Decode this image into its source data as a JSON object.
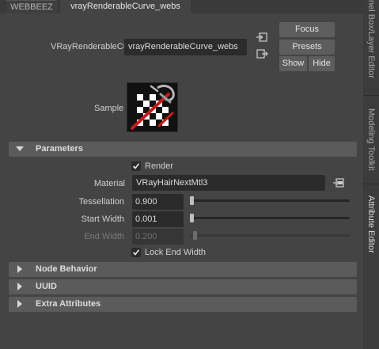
{
  "tabs": [
    {
      "label": "WEBBEEZ"
    },
    {
      "label": "vrayRenderableCurve_webs"
    }
  ],
  "side_tabs": [
    {
      "label": "nel Box/Layer Editor"
    },
    {
      "label": "Modeling Toolkit"
    },
    {
      "label": "Attribute Editor"
    }
  ],
  "node": {
    "label": "VRayRenderableCurve:",
    "value": "vrayRenderableCurve_webs"
  },
  "buttons": {
    "focus": "Focus",
    "presets": "Presets",
    "show": "Show",
    "hide": "Hide"
  },
  "sample": {
    "label": "Sample"
  },
  "frames": {
    "parameters": "Parameters",
    "node_behavior": "Node Behavior",
    "uuid": "UUID",
    "extra_attributes": "Extra Attributes"
  },
  "params": {
    "render": {
      "label": "Render",
      "checked": true
    },
    "material": {
      "label": "Material",
      "value": "VRayHairNextMtl3"
    },
    "tessellation": {
      "label": "Tessellation",
      "value": "0.900",
      "slider_fraction": 0.0
    },
    "start_width": {
      "label": "Start Width",
      "value": "0.001",
      "slider_fraction": 0.0
    },
    "end_width": {
      "label": "End Width",
      "value": "0.200",
      "slider_fraction": 0.02,
      "disabled": true
    },
    "lock_end_width": {
      "label": "Lock End Width",
      "checked": true
    }
  }
}
